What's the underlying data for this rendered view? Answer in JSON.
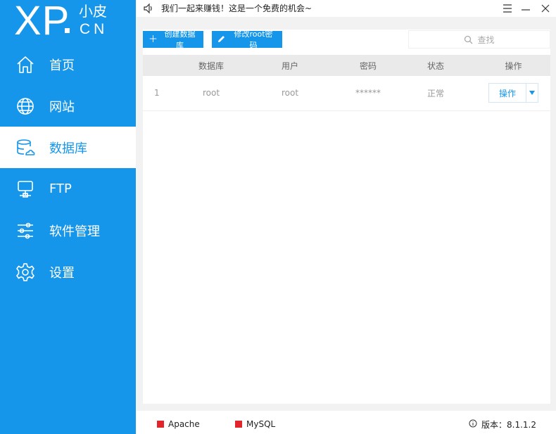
{
  "logo": {
    "xp": "XP",
    "cn_top": "小皮",
    "cn_bottom": "CN"
  },
  "topbar": {
    "notice": "我们一起来赚钱！这是一个免费的机会~"
  },
  "sidebar": {
    "items": [
      {
        "label": "首页",
        "icon": "home-icon",
        "active": false
      },
      {
        "label": "网站",
        "icon": "globe-icon",
        "active": false
      },
      {
        "label": "数据库",
        "icon": "database-icon",
        "active": true
      },
      {
        "label": "FTP",
        "icon": "ftp-server-icon",
        "active": false
      },
      {
        "label": "软件管理",
        "icon": "sliders-icon",
        "active": false
      },
      {
        "label": "设置",
        "icon": "gear-icon",
        "active": false
      }
    ]
  },
  "toolbar": {
    "create_label": "创建数据库",
    "change_pwd_label": "修改root密码",
    "search_placeholder": "查找"
  },
  "table": {
    "headers": [
      "",
      "数据库",
      "用户",
      "密码",
      "状态",
      "操作"
    ],
    "rows": [
      {
        "index": "1",
        "database": "root",
        "user": "root",
        "password": "******",
        "status": "正常",
        "action": "操作"
      }
    ]
  },
  "statusbar": {
    "services": [
      {
        "name": "Apache",
        "color": "#e0262b"
      },
      {
        "name": "MySQL",
        "color": "#e0262b"
      }
    ],
    "version": "版本：8.1.1.2"
  },
  "colors": {
    "accent": "#1596ea",
    "stopped": "#e0262b"
  }
}
